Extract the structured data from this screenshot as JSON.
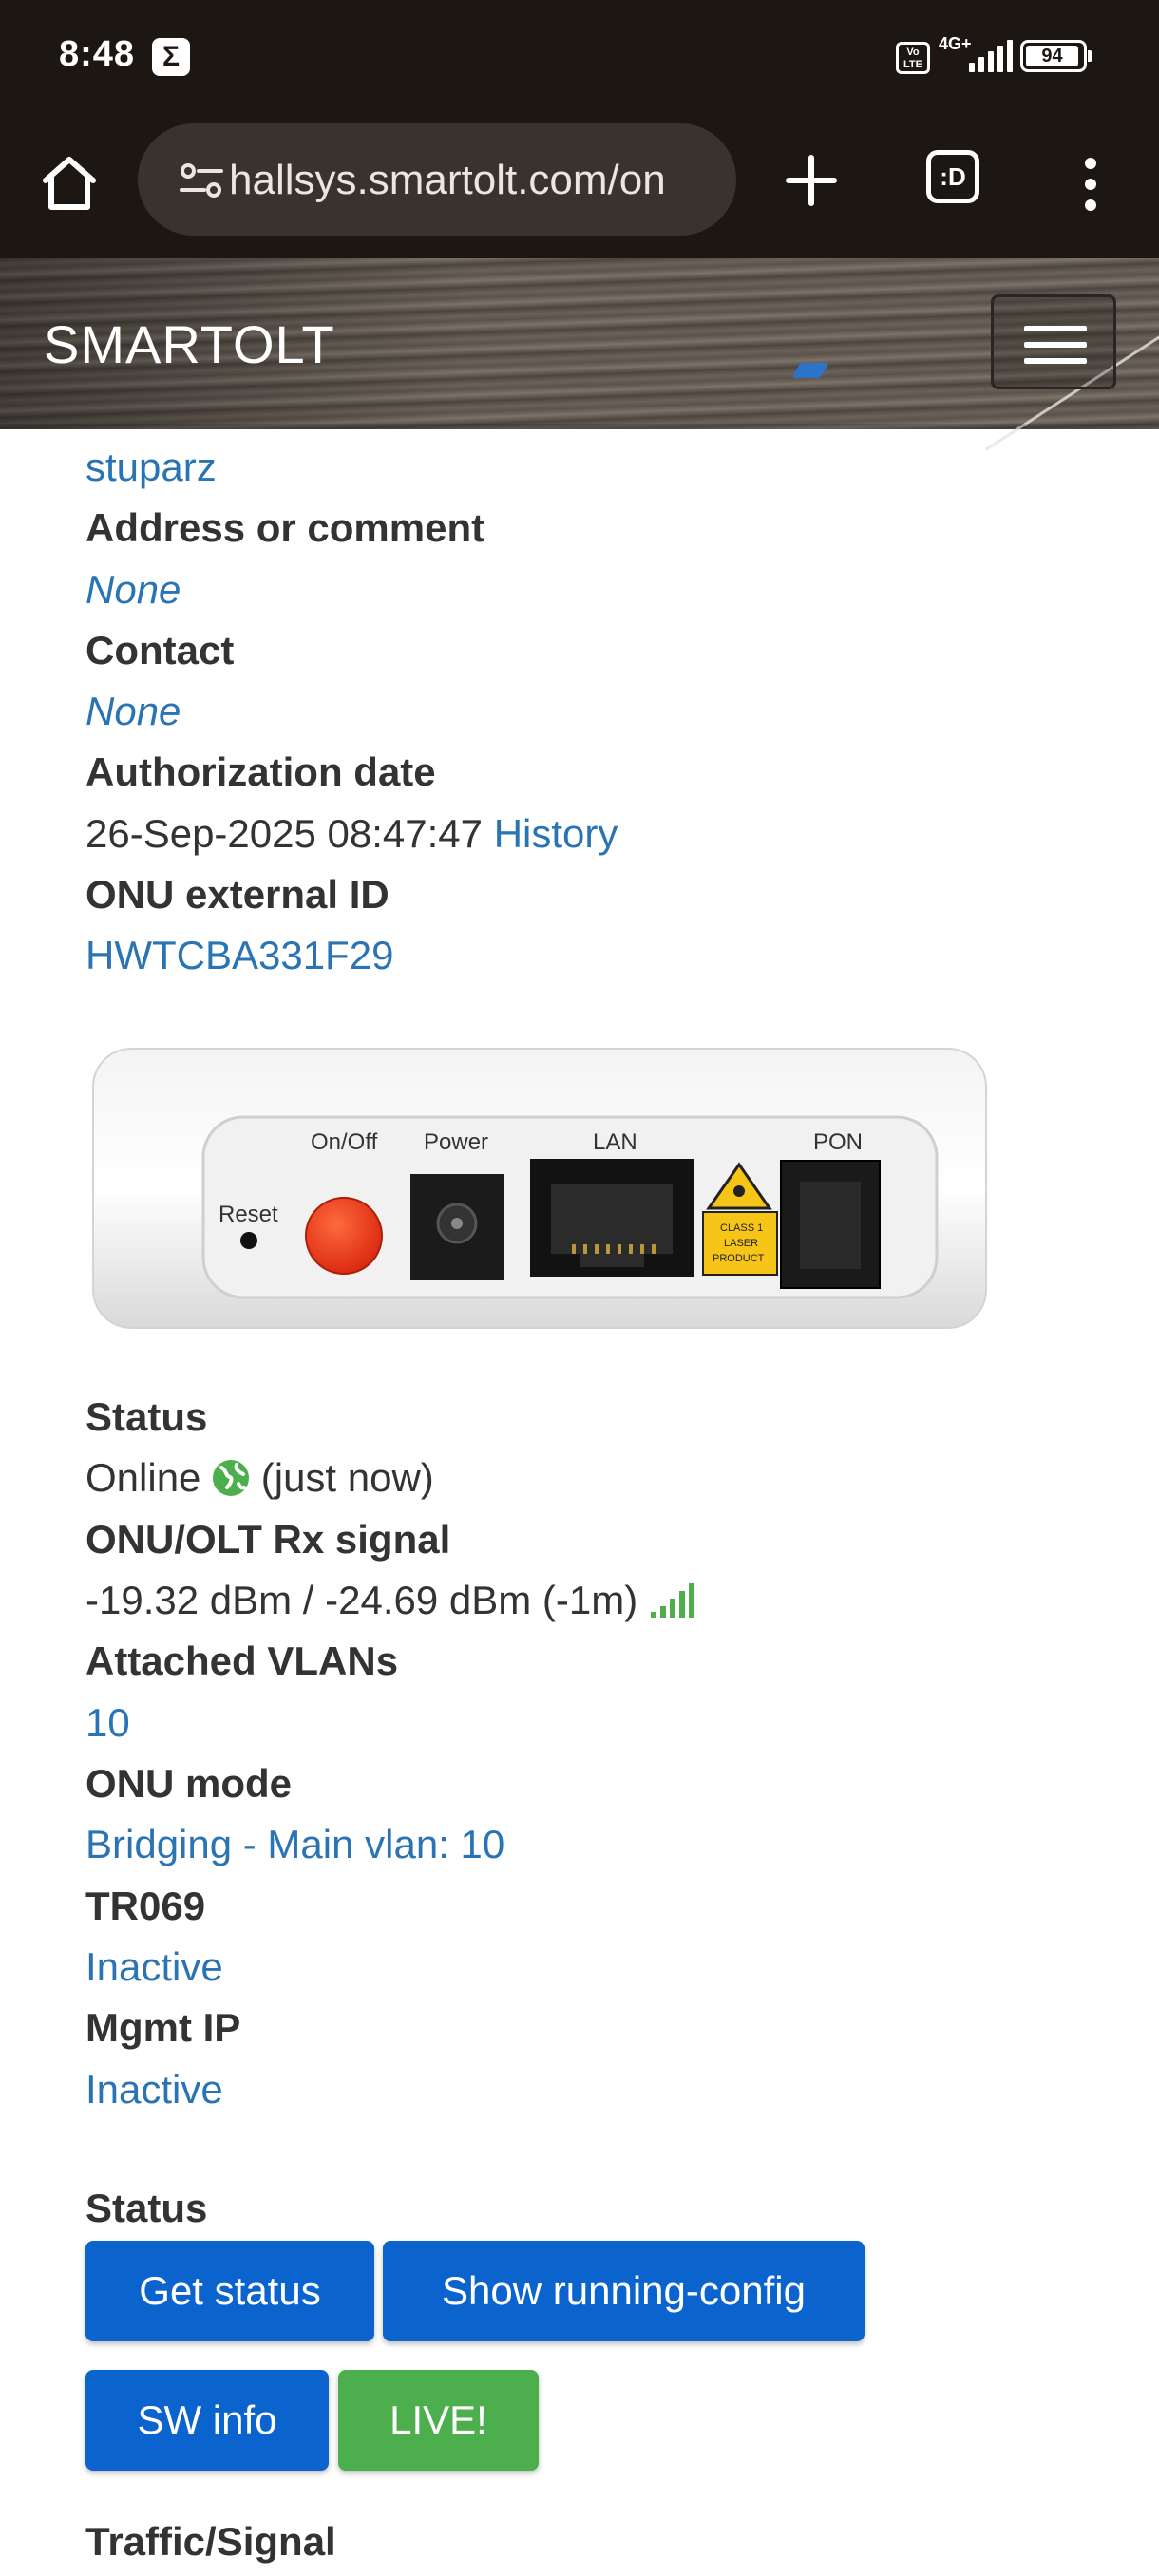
{
  "status_bar": {
    "time": "8:48",
    "sigma_icon": "Σ",
    "volte": "Vo LTE",
    "network": "4G+",
    "battery": "94"
  },
  "browser": {
    "url": "hallsys.smartolt.com/on",
    "tab_switcher_label": ":D"
  },
  "navbar": {
    "brand": "SMARTOLT"
  },
  "details": {
    "username_link": "stuparz",
    "address_label": "Address or comment",
    "address_value": "None",
    "contact_label": "Contact",
    "contact_value": "None",
    "auth_date_label": "Authorization date",
    "auth_date_value": "26-Sep-2025 08:47:47",
    "history_link": "History",
    "external_id_label": "ONU external ID",
    "external_id_value": "HWTCBA331F29"
  },
  "device_image": {
    "reset_label": "Reset",
    "onoff_label": "On/Off",
    "power_label": "Power",
    "lan_label": "LAN",
    "pon_label": "PON",
    "laser_label_1": "CLASS 1",
    "laser_label_2": "LASER",
    "laser_label_3": "PRODUCT"
  },
  "status_info": {
    "status_label": "Status",
    "status_value": "Online",
    "status_time": "(just now)",
    "rx_label": "ONU/OLT Rx signal",
    "rx_value": "-19.32 dBm / -24.69 dBm (-1m)",
    "vlans_label": "Attached VLANs",
    "vlans_value": "10",
    "mode_label": "ONU mode",
    "mode_value": "Bridging - Main vlan: 10",
    "tr069_label": "TR069",
    "tr069_value": "Inactive",
    "mgmt_label": "Mgmt IP",
    "mgmt_value": "Inactive"
  },
  "actions": {
    "section_label": "Status",
    "get_status": "Get status",
    "show_running_config": "Show running-config",
    "sw_info": "SW info",
    "live": "LIVE!"
  },
  "next_section": "Traffic/Signal",
  "colors": {
    "link": "#2a74b4",
    "primary_button": "#0b63ce",
    "live_button": "#4cae4c",
    "online_icon": "#4cae4c",
    "browser_chrome": "#1d1714"
  }
}
